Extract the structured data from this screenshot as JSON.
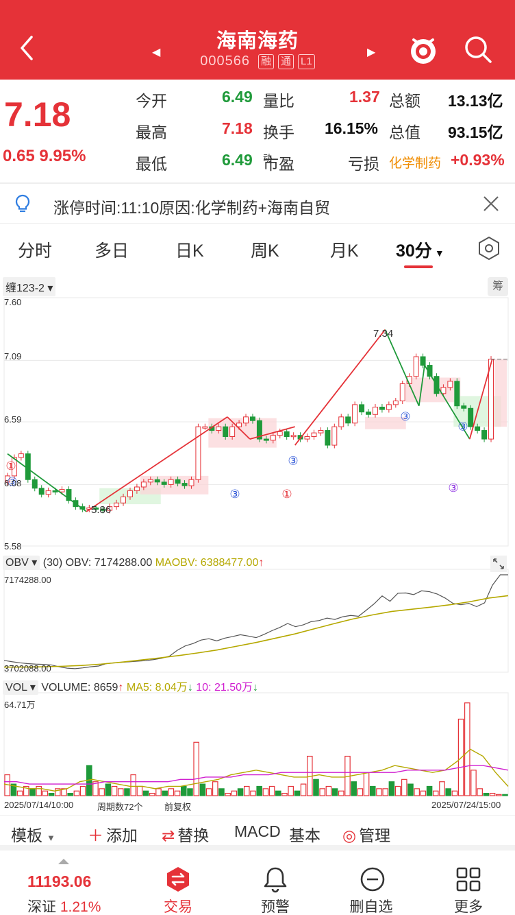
{
  "header": {
    "stock_name": "海南海药",
    "stock_code": "000566",
    "tags": [
      "融",
      "通",
      "L1"
    ]
  },
  "quote": {
    "price": "7.18",
    "change": "0.65",
    "change_pct": "9.95%",
    "rows": [
      {
        "l1": "今开",
        "v1": "6.49",
        "l2": "量比",
        "v2": "1.37",
        "l3": "总额",
        "v3": "13.13亿"
      },
      {
        "l1": "最高",
        "v1": "7.18",
        "l2": "换手",
        "v2": "16.15%",
        "l3": "总值",
        "v3": "93.15亿"
      },
      {
        "l1": "最低",
        "v1": "6.49",
        "l2": "市盈",
        "l2sup": "动",
        "v2": "",
        "l3": "亏损",
        "v3sector": "化学制药",
        "v3": "+0.93%"
      }
    ]
  },
  "notice": {
    "text": "涨停时间:11:10原因:化学制药+海南自贸"
  },
  "tabs": {
    "items": [
      "分时",
      "多日",
      "日K",
      "周K",
      "月K",
      "30分"
    ],
    "active": "30分"
  },
  "kline_panel": {
    "indicator_label": "缠123-2",
    "chip_label": "筹",
    "y_labels": [
      "7.60",
      "7.09",
      "6.59",
      "6.08",
      "5.58"
    ],
    "high_label": "7.34",
    "low_label": "5.86"
  },
  "obv_panel": {
    "label": "OBV",
    "period": "(30)",
    "obv_text": "OBV: 7174288.00",
    "maobv_text": "MAOBV: 6388477.00",
    "top_label": "7174288.00",
    "bottom_label": "3702088.00"
  },
  "vol_panel": {
    "label": "VOL",
    "volume_text": "VOLUME: 8659",
    "ma5_text": "MA5: 8.04万",
    "ma10_text": "10: 21.50万",
    "top_label": "64.71万",
    "start_date": "2025/07/14/10:00",
    "period_count": "周期数72个",
    "adjust": "前复权",
    "end_date": "2025/07/24/15:00"
  },
  "toolbar": {
    "template": "模板",
    "add": "添加",
    "replace": "替换",
    "macd": "MACD",
    "basic": "基本",
    "manage": "管理"
  },
  "bottom": {
    "index_value": "11193.06",
    "index_name": "深证",
    "index_change": "1.21%",
    "trade": "交易",
    "alert": "预警",
    "remove": "删自选",
    "more": "更多"
  },
  "colors": {
    "brand_red": "#e53238",
    "up_red": "#e53238",
    "down_green": "#1f9a3a",
    "ma5_olive": "#b5a800",
    "ma10_magenta": "#d020d0"
  },
  "chart_data": [
    {
      "type": "candlestick",
      "title": "",
      "y_axis_ticks": [
        7.6,
        7.09,
        6.59,
        6.08,
        5.58
      ],
      "ylim": [
        5.58,
        7.6
      ],
      "annotations": [
        "7.34",
        "5.86"
      ],
      "close": [
        6.15,
        6.3,
        6.33,
        6.12,
        6.05,
        6.0,
        6.03,
        6.02,
        6.04,
        5.95,
        5.9,
        5.88,
        5.89,
        5.88,
        5.87,
        5.9,
        5.93,
        5.98,
        6.03,
        6.06,
        6.1,
        6.12,
        6.1,
        6.08,
        6.12,
        6.09,
        6.07,
        6.12,
        6.55,
        6.55,
        6.52,
        6.55,
        6.47,
        6.55,
        6.58,
        6.63,
        6.6,
        6.45,
        6.44,
        6.48,
        6.51,
        6.47,
        6.48,
        6.45,
        6.47,
        6.5,
        6.52,
        6.4,
        6.55,
        6.63,
        6.58,
        6.73,
        6.67,
        6.65,
        6.71,
        6.69,
        6.73,
        6.76,
        6.9,
        6.96,
        7.12,
        7.05,
        6.96,
        6.82,
        6.87,
        6.92,
        6.72,
        6.7,
        6.55,
        6.52,
        6.45,
        7.1
      ]
    },
    {
      "type": "line",
      "title": "OBV",
      "series": [
        {
          "name": "OBV",
          "values": [
            3.97,
            3.92,
            3.88,
            3.85,
            3.83,
            3.82,
            3.8,
            3.73,
            3.68,
            3.66,
            3.69,
            3.73,
            3.76,
            3.85,
            3.88,
            3.9,
            3.92,
            3.94,
            3.96,
            4.0,
            4.05,
            4.13,
            4.35,
            4.51,
            4.6,
            4.73,
            4.78,
            4.7,
            4.8,
            4.86,
            4.93,
            4.88,
            4.82,
            4.94,
            5.08,
            5.2,
            5.35,
            5.23,
            5.3,
            5.42,
            5.46,
            5.55,
            5.5,
            5.6,
            5.65,
            5.62,
            5.85,
            6.09,
            6.38,
            6.18,
            6.48,
            6.49,
            6.43,
            6.57,
            6.54,
            6.45,
            6.3,
            6.1,
            6.05,
            6.1,
            5.98,
            6.12,
            6.78,
            7.17,
            7.17
          ]
        },
        {
          "name": "MAOBV",
          "values": [
            3.72,
            3.72,
            3.73,
            3.75,
            3.78,
            3.83,
            3.9,
            3.98,
            4.06,
            4.15,
            4.25,
            4.36,
            4.5,
            4.64,
            4.8,
            4.96,
            5.15,
            5.34,
            5.52,
            5.67,
            5.8,
            5.88,
            5.96,
            6.05,
            6.16,
            6.3,
            6.39
          ]
        }
      ],
      "ylabels": [
        "7174288.00",
        "3702088.00"
      ]
    },
    {
      "type": "bar",
      "title": "VOL",
      "ylim_label": "64.71万",
      "series": [
        {
          "name": "VOLUME",
          "values": [
            9,
            5,
            2,
            4,
            3,
            4,
            2,
            1,
            3,
            3,
            1,
            2,
            4,
            13,
            6,
            3,
            5,
            4,
            3,
            3,
            9,
            4,
            2,
            1,
            3,
            2,
            3,
            2,
            4,
            3,
            23,
            5,
            3,
            6,
            3,
            1,
            2,
            3,
            4,
            2,
            4,
            3,
            4,
            2,
            1,
            4,
            2,
            5,
            17,
            7,
            3,
            4,
            3,
            2,
            17,
            6,
            3,
            10,
            4,
            3,
            3,
            6,
            4,
            7,
            5,
            3,
            2,
            4,
            2,
            6,
            3,
            2,
            33,
            40,
            11,
            3,
            1,
            1,
            0.5,
            0.5
          ]
        },
        {
          "name": "MA5",
          "values": [
            5,
            4,
            3,
            3,
            2,
            3,
            6,
            7,
            6,
            5,
            4,
            4,
            3,
            4,
            4,
            5,
            6,
            7,
            9,
            10,
            11,
            10,
            9,
            8,
            8,
            9,
            8,
            8,
            9,
            10,
            11,
            13,
            12,
            11,
            10,
            11,
            15,
            20,
            17,
            10,
            4
          ]
        },
        {
          "name": "10",
          "values": [
            6,
            6,
            5,
            5,
            5,
            5,
            5,
            5,
            6,
            6,
            6,
            6,
            6,
            6,
            7,
            7,
            8,
            8,
            8,
            9,
            9,
            9,
            10,
            10,
            10,
            10,
            10,
            10,
            10,
            10,
            10,
            10,
            11,
            11,
            11,
            11,
            12,
            13,
            13,
            12,
            11
          ]
        }
      ],
      "x_labels": [
        "2025/07/14/10:00",
        "2025/07/24/15:00"
      ]
    }
  ]
}
